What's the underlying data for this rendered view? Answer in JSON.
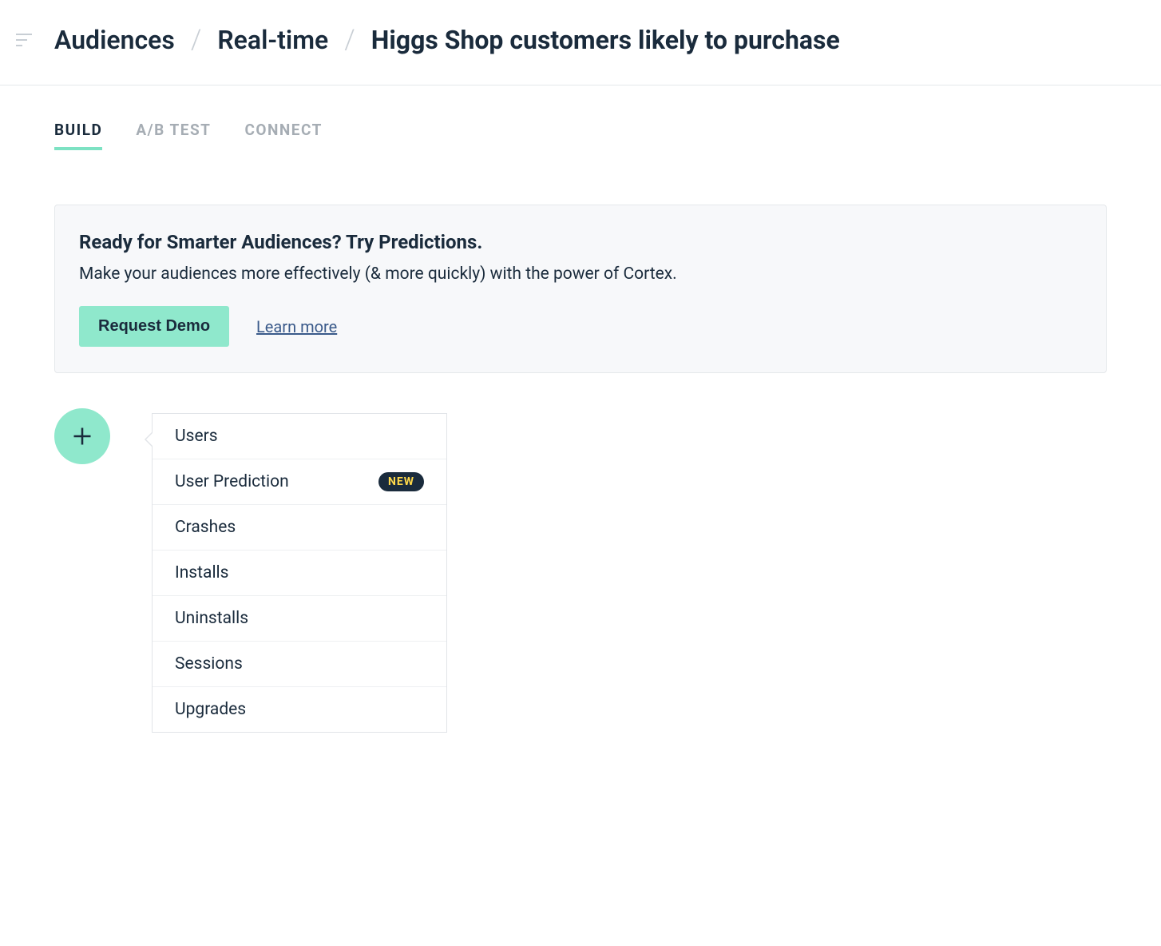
{
  "breadcrumb": {
    "items": [
      "Audiences",
      "Real-time"
    ],
    "current": "Higgs Shop customers likely to purchase"
  },
  "tabs": [
    {
      "label": "BUILD",
      "active": true
    },
    {
      "label": "A/B TEST",
      "active": false
    },
    {
      "label": "CONNECT",
      "active": false
    }
  ],
  "promo": {
    "title": "Ready for Smarter Audiences? Try Predictions.",
    "description": "Make your audiences more effectively (& more quickly) with the power of Cortex.",
    "cta_label": "Request Demo",
    "link_label": "Learn more"
  },
  "dropdown": {
    "items": [
      {
        "label": "Users",
        "badge": null
      },
      {
        "label": "User Prediction",
        "badge": "NEW"
      },
      {
        "label": "Crashes",
        "badge": null
      },
      {
        "label": "Installs",
        "badge": null
      },
      {
        "label": "Uninstalls",
        "badge": null
      },
      {
        "label": "Sessions",
        "badge": null
      },
      {
        "label": "Upgrades",
        "badge": null
      }
    ]
  }
}
